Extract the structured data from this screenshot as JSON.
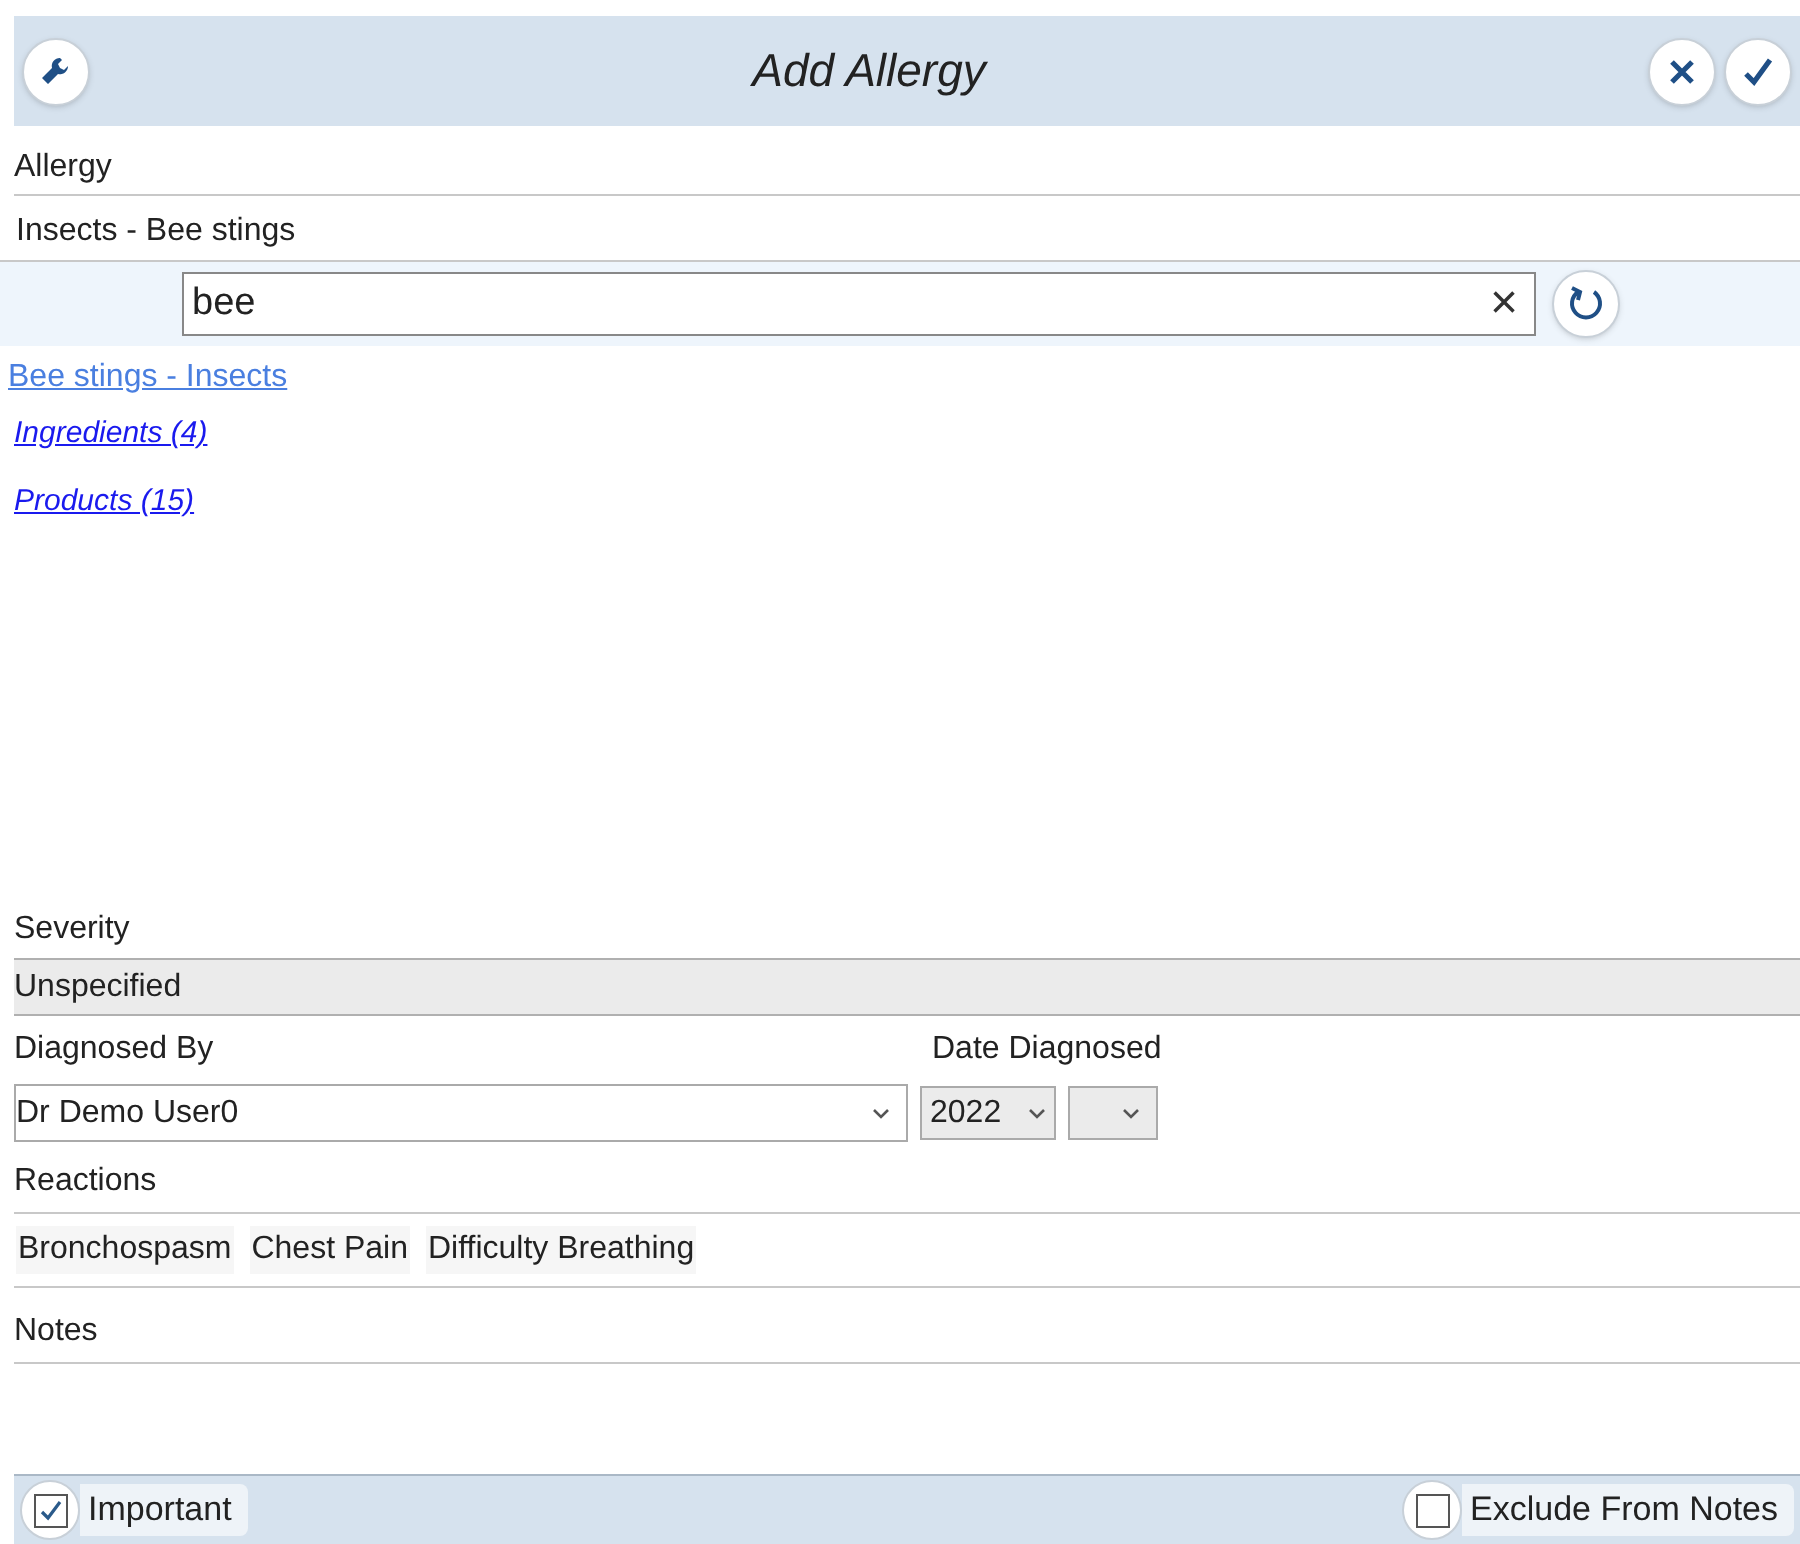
{
  "window": {
    "title": "Add Allergy"
  },
  "allergy": {
    "label": "Allergy",
    "value": "Insects - Bee stings"
  },
  "search": {
    "value": "bee",
    "clear": "×"
  },
  "results": [
    {
      "text": "Bee stings - Insects",
      "kind": "match"
    },
    {
      "text": "Ingredients (4)",
      "kind": "group"
    },
    {
      "text": "Products (15)",
      "kind": "group"
    }
  ],
  "severity": {
    "label": "Severity",
    "value": "Unspecified"
  },
  "diagnosed_by": {
    "label": "Diagnosed By",
    "value": "Dr Demo User0"
  },
  "date_diagnosed": {
    "label": "Date Diagnosed",
    "year": "2022"
  },
  "reactions": {
    "label": "Reactions",
    "items": [
      "Bronchospasm",
      "Chest Pain",
      "Difficulty Breathing"
    ]
  },
  "notes": {
    "label": "Notes"
  },
  "footer": [
    {
      "label": "Important",
      "checked": true
    },
    {
      "label": "Exclude From Notes",
      "checked": false
    }
  ]
}
